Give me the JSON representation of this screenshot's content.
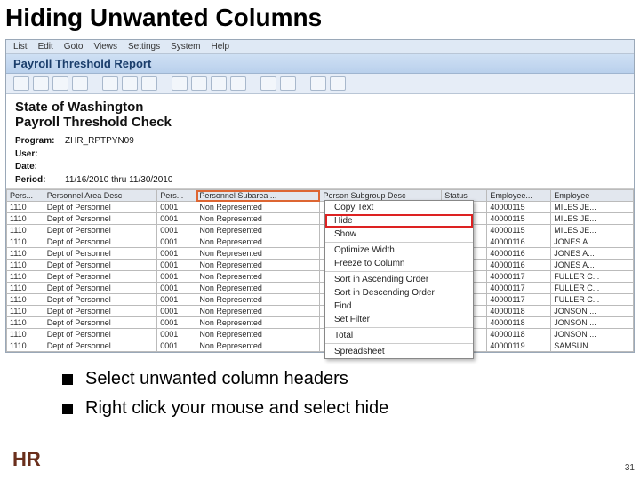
{
  "slide": {
    "title": "Hiding Unwanted Columns",
    "pageNumber": "31",
    "bullets": [
      "Select unwanted column headers",
      "Right click your mouse and select hide"
    ],
    "logoText": "HR",
    "logoSub": "State of Washington"
  },
  "app": {
    "menubar": [
      "List",
      "Edit",
      "Goto",
      "Views",
      "Settings",
      "System",
      "Help"
    ],
    "reportTitle": "Payroll Threshold Report",
    "header": {
      "org": "State of Washington",
      "check": "Payroll Threshold Check",
      "program": "ZHR_RPTPYN09",
      "user": "",
      "date": "",
      "period": "11/16/2010 thru 11/30/2010",
      "labels": {
        "program": "Program:",
        "user": "User:",
        "date": "Date:",
        "period": "Period:"
      }
    },
    "columns": [
      "Pers...",
      "Personnel Area Desc",
      "Pers...",
      "Personnel Subarea ...",
      "Person Subgroup Desc",
      "Status",
      "Employee...",
      "Employee"
    ],
    "highlightCol": 3,
    "rows": [
      [
        "1110",
        "Dept of Personnel",
        "0001",
        "Non Represented",
        "",
        "",
        "40000115",
        "MILES JE..."
      ],
      [
        "1110",
        "Dept of Personnel",
        "0001",
        "Non Represented",
        "",
        "",
        "40000115",
        "MILES JE..."
      ],
      [
        "1110",
        "Dept of Personnel",
        "0001",
        "Non Represented",
        "",
        "",
        "40000115",
        "MILES JE..."
      ],
      [
        "1110",
        "Dept of Personnel",
        "0001",
        "Non Represented",
        "",
        "",
        "40000116",
        "JONES A..."
      ],
      [
        "1110",
        "Dept of Personnel",
        "0001",
        "Non Represented",
        "",
        "",
        "40000116",
        "JONES A..."
      ],
      [
        "1110",
        "Dept of Personnel",
        "0001",
        "Non Represented",
        "",
        "",
        "40000116",
        "JONES A..."
      ],
      [
        "1110",
        "Dept of Personnel",
        "0001",
        "Non Represented",
        "",
        "",
        "40000117",
        "FULLER C..."
      ],
      [
        "1110",
        "Dept of Personnel",
        "0001",
        "Non Represented",
        "",
        "",
        "40000117",
        "FULLER C..."
      ],
      [
        "1110",
        "Dept of Personnel",
        "0001",
        "Non Represented",
        "",
        "",
        "40000117",
        "FULLER C..."
      ],
      [
        "1110",
        "Dept of Personnel",
        "0001",
        "Non Represented",
        "",
        "",
        "40000118",
        "JONSON ..."
      ],
      [
        "1110",
        "Dept of Personnel",
        "0001",
        "Non Represented",
        "",
        "",
        "40000118",
        "JONSON ..."
      ],
      [
        "1110",
        "Dept of Personnel",
        "0001",
        "Non Represented",
        "",
        "",
        "40000118",
        "JONSON ..."
      ],
      [
        "1110",
        "Dept of Personnel",
        "0001",
        "Non Represented",
        "",
        "",
        "40000119",
        "SAMSUN..."
      ]
    ],
    "contextMenu": [
      {
        "label": "Copy Text",
        "int": true
      },
      {
        "label": "Hide",
        "int": true,
        "hl": true
      },
      {
        "label": "Show",
        "int": true
      },
      {
        "sep": true
      },
      {
        "label": "Optimize Width",
        "int": true
      },
      {
        "label": "Freeze to Column",
        "int": true
      },
      {
        "sep": true
      },
      {
        "label": "Sort in Ascending Order",
        "int": true
      },
      {
        "label": "Sort in Descending Order",
        "int": true
      },
      {
        "label": "Find",
        "int": true
      },
      {
        "label": "Set Filter",
        "int": true
      },
      {
        "sep": true
      },
      {
        "label": "Total",
        "int": true
      },
      {
        "sep": true
      },
      {
        "label": "Spreadsheet",
        "int": true
      }
    ]
  }
}
